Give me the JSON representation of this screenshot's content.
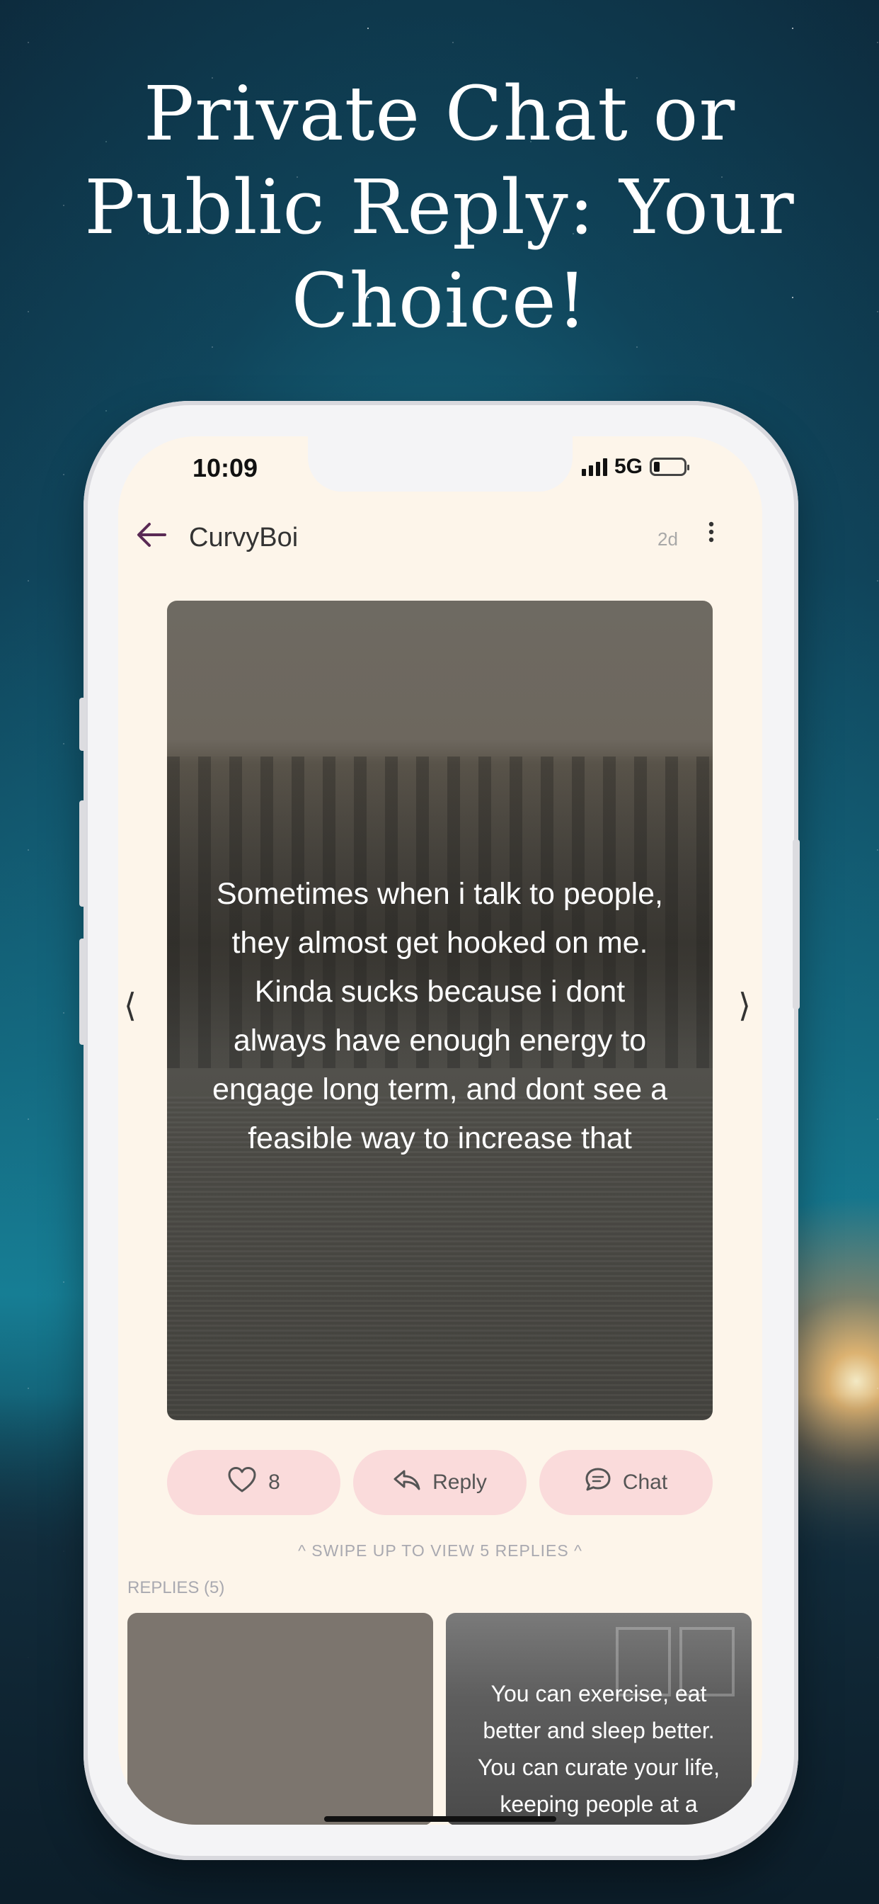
{
  "headline": {
    "lines": [
      "Private Chat or",
      "Public Reply: Your",
      "Choice!"
    ]
  },
  "status_bar": {
    "time": "10:09",
    "network": "5G"
  },
  "header": {
    "username": "CurvyBoi",
    "age": "2d",
    "back_icon": "arrow-left-icon",
    "more_icon": "more-vertical-icon"
  },
  "post": {
    "text_lines": [
      "Sometimes when i talk to people,",
      "they almost get hooked on me.",
      "Kinda sucks because i dont",
      "always have enough energy to",
      "engage long term, and dont see a",
      "feasible way to increase that"
    ],
    "prev_glyph": "⟨",
    "next_glyph": "⟩"
  },
  "actions": {
    "like_count": "8",
    "reply_label": "Reply",
    "chat_label": "Chat",
    "accent_color": "#fadbdb"
  },
  "swipe_hint": "^ SWIPE UP TO VIEW 5 REPLIES ^",
  "replies": {
    "label": "REPLIES (5)",
    "items": [
      {
        "text_lines": []
      },
      {
        "text_lines": [
          "You can exercise, eat",
          "better and sleep better.",
          "You can curate your life,",
          "keeping people at a"
        ]
      }
    ]
  }
}
